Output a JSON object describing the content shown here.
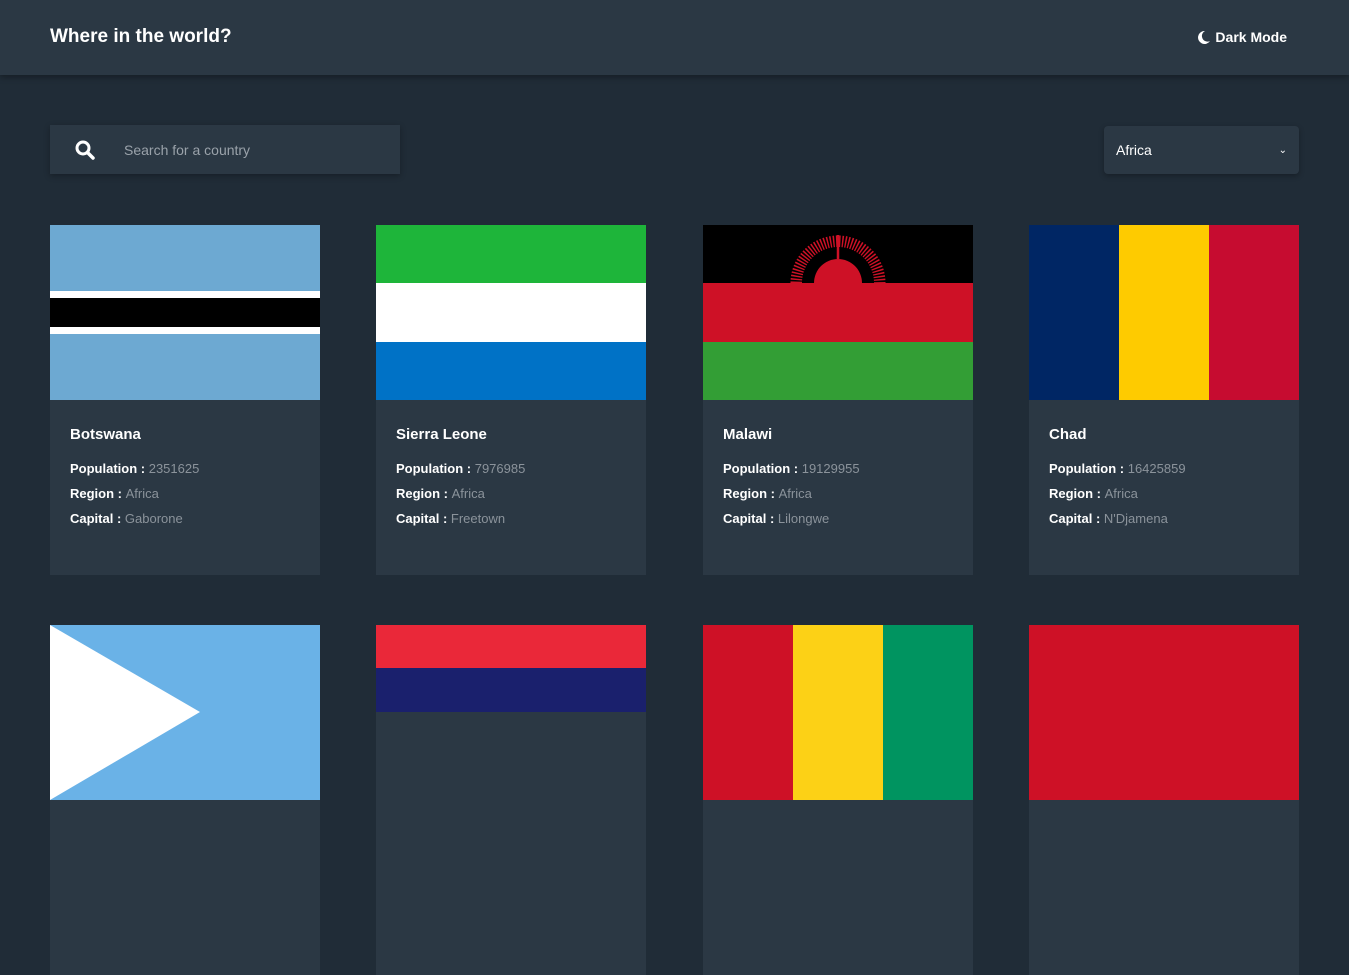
{
  "header": {
    "title": "Where in the world?",
    "dark_mode_label": "Dark Mode"
  },
  "search": {
    "placeholder": "Search for a country",
    "value": ""
  },
  "filter": {
    "selected": "Africa"
  },
  "labels": {
    "population": "Population : ",
    "region": "Region : ",
    "capital": "Capital : "
  },
  "countries": [
    {
      "name": "Botswana",
      "population": "2351625",
      "region": "Africa",
      "capital": "Gaborone"
    },
    {
      "name": "Sierra Leone",
      "population": "7976985",
      "region": "Africa",
      "capital": "Freetown"
    },
    {
      "name": "Malawi",
      "population": "19129955",
      "region": "Africa",
      "capital": "Lilongwe"
    },
    {
      "name": "Chad",
      "population": "16425859",
      "region": "Africa",
      "capital": "N'Djamena"
    }
  ]
}
